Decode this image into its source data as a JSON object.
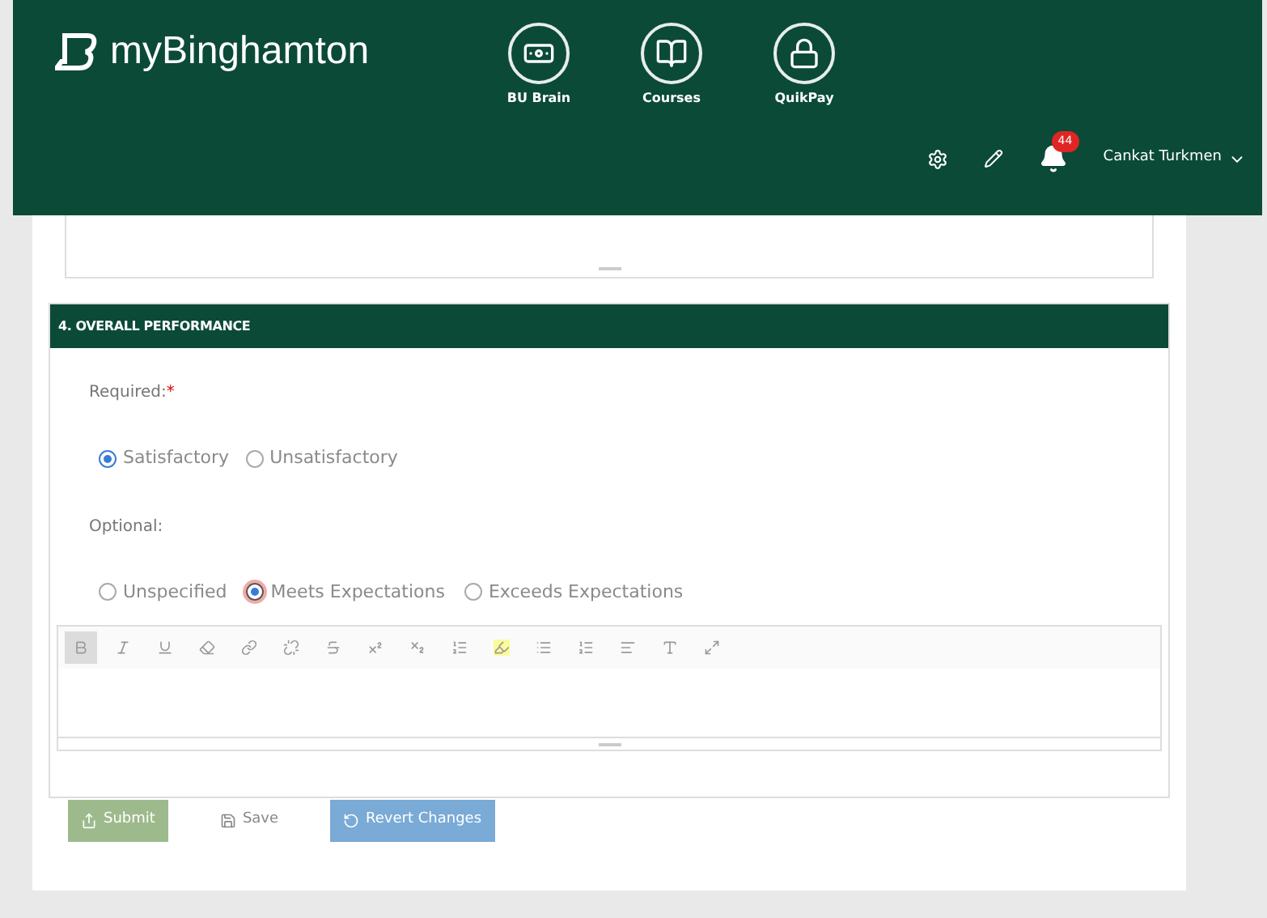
{
  "header": {
    "brand": "myBinghamton",
    "apps": [
      {
        "label": "BU Brain",
        "kind": "money"
      },
      {
        "label": "Courses",
        "kind": "book"
      },
      {
        "label": "QuikPay",
        "kind": "lock"
      }
    ],
    "notifications": "44",
    "user": "Cankat Turkmen"
  },
  "section": {
    "title": "4. OVERALL PERFORMANCE",
    "required_label": "Required:",
    "required_mark": "*",
    "required_options": [
      {
        "label": "Satisfactory",
        "selected": true
      },
      {
        "label": "Unsatisfactory",
        "selected": false
      }
    ],
    "optional_label": "Optional:",
    "optional_options": [
      {
        "label": "Unspecified",
        "selected": false
      },
      {
        "label": "Meets Expectations",
        "selected": true
      },
      {
        "label": "Exceeds Expectations",
        "selected": false
      }
    ],
    "toolbar": [
      {
        "kind": "bold",
        "active": true
      },
      {
        "kind": "italic",
        "active": false
      },
      {
        "kind": "underline",
        "active": false
      },
      {
        "kind": "eraser",
        "active": false
      },
      {
        "kind": "link",
        "active": false
      },
      {
        "kind": "unlink",
        "active": false
      },
      {
        "kind": "strike",
        "active": false
      },
      {
        "kind": "superscript",
        "active": false
      },
      {
        "kind": "subscript",
        "active": false
      },
      {
        "kind": "list-dropdown",
        "active": false
      },
      {
        "kind": "highlight",
        "active": false
      },
      {
        "kind": "bullets",
        "active": false
      },
      {
        "kind": "numbers",
        "active": false
      },
      {
        "kind": "align",
        "active": false
      },
      {
        "kind": "text-size",
        "active": false
      },
      {
        "kind": "fullscreen",
        "active": false
      }
    ]
  },
  "buttons": [
    {
      "label": "Submit",
      "kind": "submit"
    },
    {
      "label": "Save",
      "kind": "save"
    },
    {
      "label": "Revert Changes",
      "kind": "revert"
    }
  ]
}
